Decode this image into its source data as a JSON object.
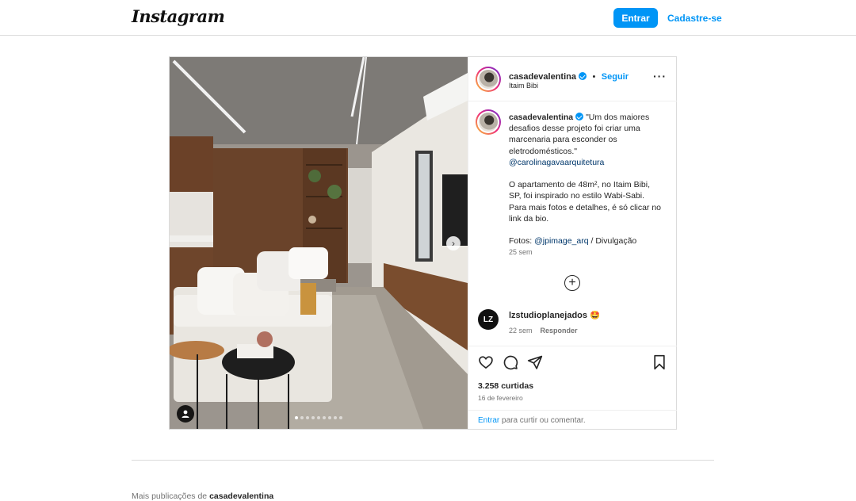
{
  "header": {
    "logo": "Instagram",
    "login_label": "Entrar",
    "signup_label": "Cadastre-se"
  },
  "post": {
    "username": "casadevalentina",
    "separator": "•",
    "follow_label": "Seguir",
    "location": "Itaim Bibi",
    "more_label": "···",
    "caption_lines": [
      "\"Um dos maiores desafios desse projeto foi criar uma marcenaria para esconder os eletrodomésticos.\"",
      "O apartamento de 48m², no Itaim Bibi, SP, foi inspirado no estilo Wabi-Sabi. Para mais fotos e detalhes, é só clicar no link da bio."
    ],
    "mention": "@carolinagavaarquitetura",
    "photo_credit_prefix": "Fotos: ",
    "photo_credit_link": "@jpimage_arq",
    "photo_credit_suffix": " / Divulgação",
    "caption_time": "25 sem",
    "add_icon": "+",
    "comment": {
      "avatar_text": "LZ",
      "username": "lzstudioplanejados",
      "text": "🤩",
      "time": "22 sem",
      "reply_label": "Responder"
    },
    "likes": "3.258 curtidas",
    "date": "16 de fevereiro",
    "login_prompt_link": "Entrar",
    "login_prompt_text": " para curtir ou comentar.",
    "carousel_count": 9,
    "carousel_active": 0,
    "next_arrow": "›"
  },
  "more_posts": {
    "prefix": "Mais publicações de ",
    "username": "casadevalentina"
  },
  "colors": {
    "accent": "#0095f6",
    "border": "#dbdbdb",
    "text": "#262626",
    "muted": "#737373"
  },
  "icons": [
    "heart-icon",
    "comment-icon",
    "share-icon",
    "bookmark-icon",
    "user-tag-icon",
    "add-circle-icon",
    "verified-icon",
    "more-icon",
    "chevron-right-icon"
  ]
}
